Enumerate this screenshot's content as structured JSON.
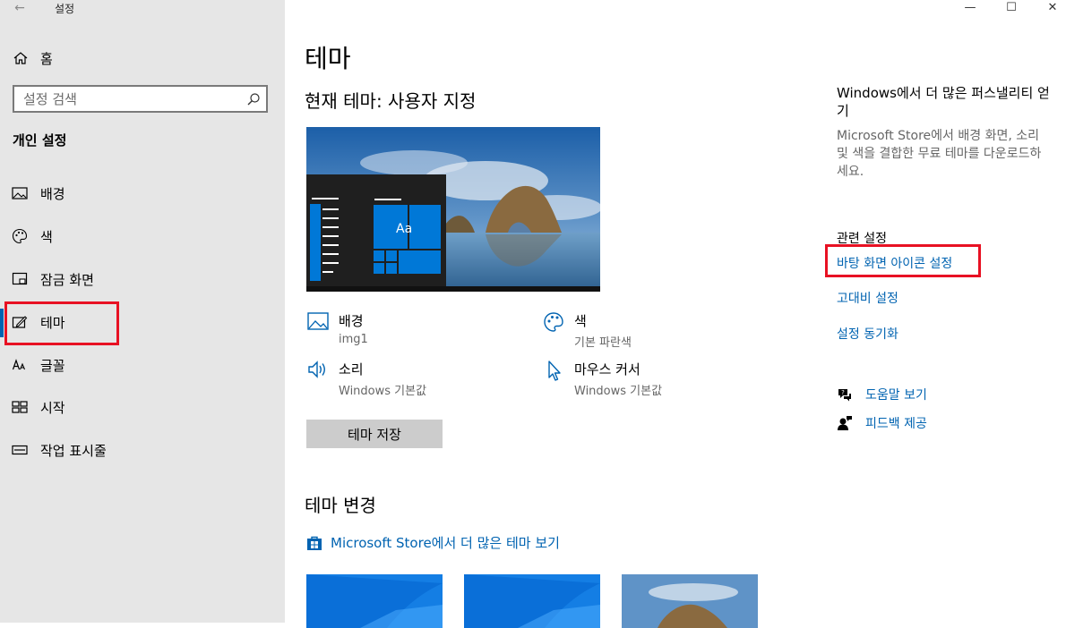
{
  "window": {
    "title": "설정",
    "controls": {
      "minimize": "—",
      "maximize": "☐",
      "close": "✕"
    }
  },
  "sidebar": {
    "home_label": "홈",
    "search_placeholder": "설정 검색",
    "section_title": "개인 설정",
    "items": [
      {
        "label": "배경",
        "icon": "image-icon"
      },
      {
        "label": "색",
        "icon": "palette-icon"
      },
      {
        "label": "잠금 화면",
        "icon": "lock-screen-icon"
      },
      {
        "label": "테마",
        "icon": "theme-icon",
        "selected": true
      },
      {
        "label": "글꼴",
        "icon": "font-icon"
      },
      {
        "label": "시작",
        "icon": "start-icon"
      },
      {
        "label": "작업 표시줄",
        "icon": "taskbar-icon"
      }
    ]
  },
  "main": {
    "page_title": "테마",
    "current_theme": "현재 테마: 사용자 지정",
    "preview_sample": "Aa",
    "properties": [
      {
        "title": "배경",
        "value": "img1",
        "icon": "image-icon"
      },
      {
        "title": "색",
        "value": "기본 파란색",
        "icon": "palette-icon"
      },
      {
        "title": "소리",
        "value": "Windows 기본값",
        "icon": "speaker-icon"
      },
      {
        "title": "마우스 커서",
        "value": "Windows 기본값",
        "icon": "cursor-icon"
      }
    ],
    "save_button": "테마 저장",
    "change_title": "테마 변경",
    "store_link": "Microsoft Store에서 더 많은 테마 보기"
  },
  "right": {
    "personalize_title": "Windows에서 더 많은 퍼스낼리티 얻기",
    "personalize_desc": "Microsoft Store에서 배경 화면, 소리 및 색을 결합한 무료 테마를 다운로드하세요.",
    "related_title": "관련 설정",
    "related_links": [
      "바탕 화면 아이콘 설정",
      "고대비 설정",
      "설정 동기화"
    ],
    "help_links": [
      {
        "label": "도움말 보기",
        "icon": "help-chat-icon"
      },
      {
        "label": "피드백 제공",
        "icon": "feedback-icon"
      }
    ]
  },
  "colors": {
    "accent": "#0063b1",
    "sidebar_bg": "#e6e6e6",
    "highlight_box": "#e81123",
    "button_bg": "#cccccc"
  }
}
